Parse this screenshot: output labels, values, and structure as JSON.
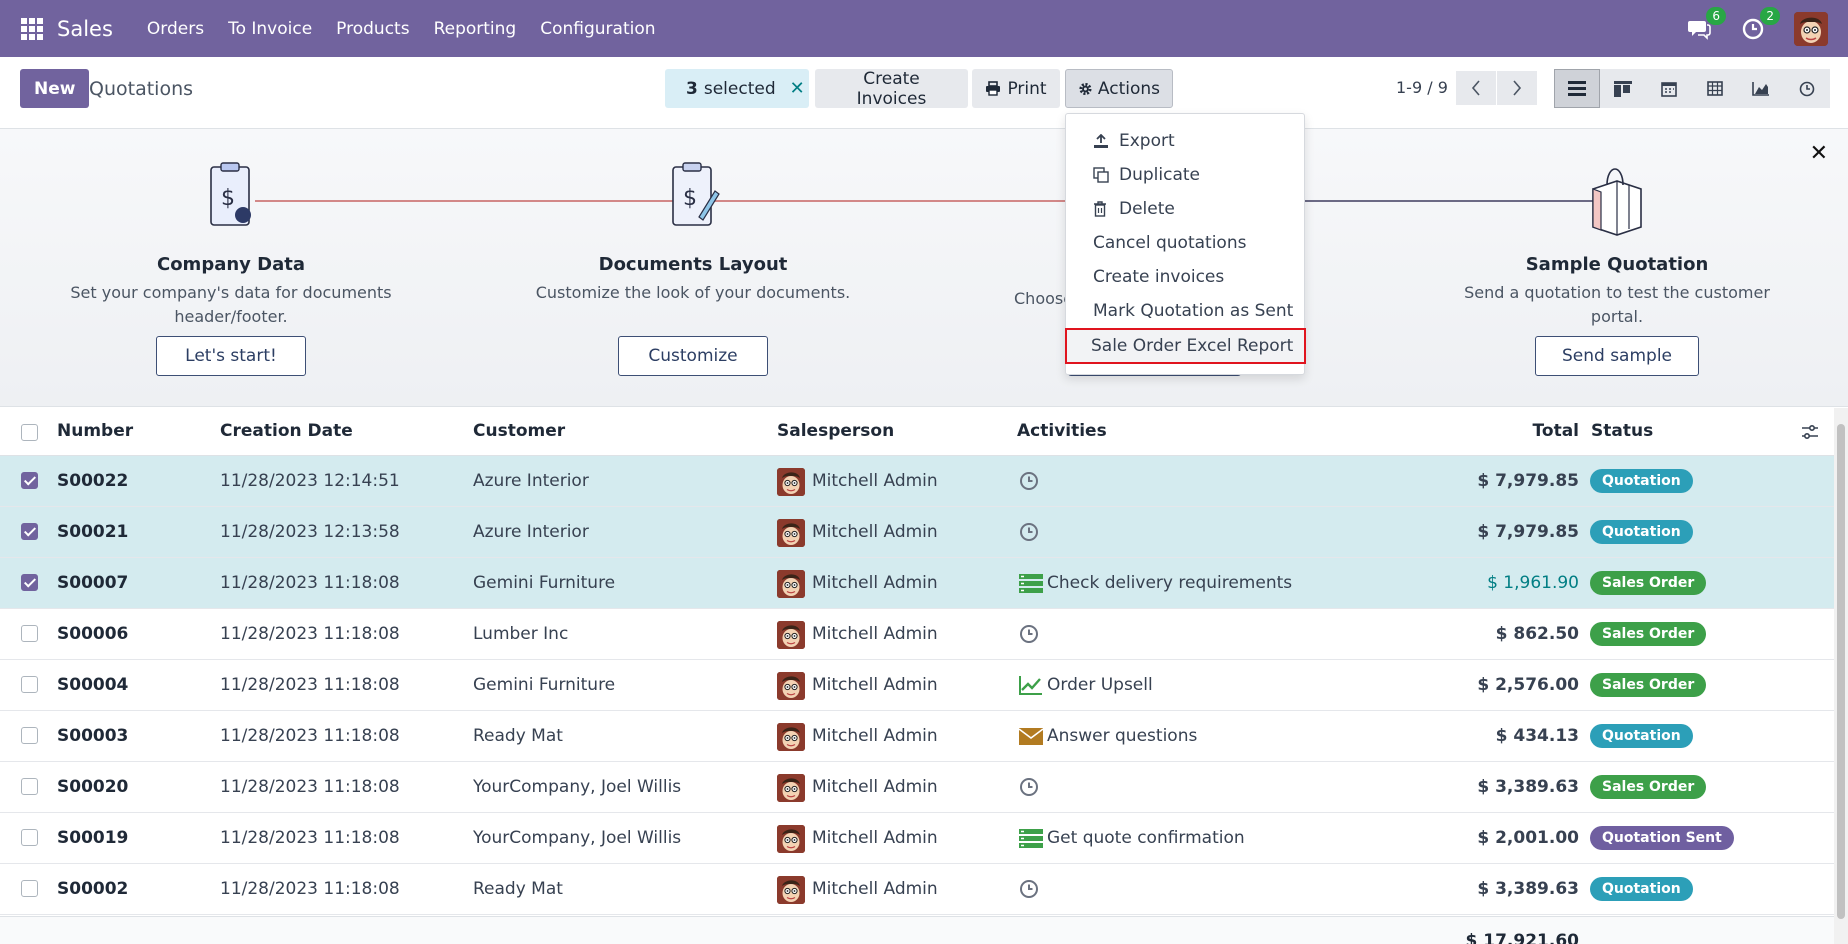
{
  "navbar": {
    "brand": "Sales",
    "items": [
      "Orders",
      "To Invoice",
      "Products",
      "Reporting",
      "Configuration"
    ],
    "messages_count": "6",
    "activities_count": "2"
  },
  "control": {
    "new_label": "New",
    "title": "Quotations",
    "selected_count": "3",
    "selected_label": "selected",
    "create_invoices": "Create Invoices",
    "print": "Print",
    "actions": "Actions",
    "pager": "1-9 / 9"
  },
  "actions_menu": [
    {
      "label": "Export",
      "icon": "upload-icon"
    },
    {
      "label": "Duplicate",
      "icon": "copy-icon"
    },
    {
      "label": "Delete",
      "icon": "trash-icon"
    },
    {
      "label": "Cancel quotations",
      "icon": ""
    },
    {
      "label": "Create invoices",
      "icon": ""
    },
    {
      "label": "Mark Quotation as Sent",
      "icon": ""
    },
    {
      "label": "Sale Order Excel Report",
      "icon": ""
    }
  ],
  "banner": {
    "steps": [
      {
        "title": "Company Data",
        "desc1": "Set your company's data for documents",
        "desc2": "header/footer.",
        "button": "Let's start!"
      },
      {
        "title": "Documents Layout",
        "desc1": "Customize the look of your documents.",
        "desc2": "",
        "button": "Customize"
      },
      {
        "title": "",
        "desc1": "Choose",
        "desc2": "",
        "button": ""
      },
      {
        "title": "Sample Quotation",
        "desc1": "Send a quotation to test the customer",
        "desc2": "portal.",
        "button": "Send sample"
      }
    ]
  },
  "table": {
    "headers": {
      "number": "Number",
      "date": "Creation Date",
      "customer": "Customer",
      "salesperson": "Salesperson",
      "activities": "Activities",
      "total": "Total",
      "status": "Status"
    },
    "rows": [
      {
        "number": "S00022",
        "date": "11/28/2023 12:14:51",
        "customer": "Azure Interior",
        "salesperson": "Mitchell Admin",
        "activity": "",
        "activity_icon": "clock-icon",
        "total": "$ 7,979.85",
        "status": "Quotation",
        "selected": true
      },
      {
        "number": "S00021",
        "date": "11/28/2023 12:13:58",
        "customer": "Azure Interior",
        "salesperson": "Mitchell Admin",
        "activity": "",
        "activity_icon": "clock-icon",
        "total": "$ 7,979.85",
        "status": "Quotation",
        "selected": true
      },
      {
        "number": "S00007",
        "date": "11/28/2023 11:18:08",
        "customer": "Gemini Furniture",
        "salesperson": "Mitchell Admin",
        "activity": "Check delivery requirements",
        "activity_icon": "tasks-icon",
        "total": "$ 1,961.90",
        "status": "Sales Order",
        "selected": true
      },
      {
        "number": "S00006",
        "date": "11/28/2023 11:18:08",
        "customer": "Lumber Inc",
        "salesperson": "Mitchell Admin",
        "activity": "",
        "activity_icon": "clock-icon",
        "total": "$ 862.50",
        "status": "Sales Order",
        "selected": false
      },
      {
        "number": "S00004",
        "date": "11/28/2023 11:18:08",
        "customer": "Gemini Furniture",
        "salesperson": "Mitchell Admin",
        "activity": "Order Upsell",
        "activity_icon": "chart-line-icon",
        "total": "$ 2,576.00",
        "status": "Sales Order",
        "selected": false
      },
      {
        "number": "S00003",
        "date": "11/28/2023 11:18:08",
        "customer": "Ready Mat",
        "salesperson": "Mitchell Admin",
        "activity": "Answer questions",
        "activity_icon": "envelope-icon",
        "total": "$ 434.13",
        "status": "Quotation",
        "selected": false
      },
      {
        "number": "S00020",
        "date": "11/28/2023 11:18:08",
        "customer": "YourCompany, Joel Willis",
        "salesperson": "Mitchell Admin",
        "activity": "",
        "activity_icon": "clock-icon",
        "total": "$ 3,389.63",
        "status": "Sales Order",
        "selected": false
      },
      {
        "number": "S00019",
        "date": "11/28/2023 11:18:08",
        "customer": "YourCompany, Joel Willis",
        "salesperson": "Mitchell Admin",
        "activity": "Get quote confirmation",
        "activity_icon": "tasks-icon",
        "total": "$ 2,001.00",
        "status": "Quotation Sent",
        "selected": false
      },
      {
        "number": "S00002",
        "date": "11/28/2023 11:18:08",
        "customer": "Ready Mat",
        "salesperson": "Mitchell Admin",
        "activity": "",
        "activity_icon": "clock-icon",
        "total": "$ 3,389.63",
        "status": "Quotation",
        "selected": false
      }
    ],
    "footer_total": "$ 17,921.60"
  },
  "colors": {
    "brand": "#71639e",
    "quotation": "#2c9fb8",
    "sales_order": "#3da049",
    "quotation_sent": "#6f5fa0",
    "link_total": "#017e84",
    "highlight_border": "#e0141e"
  }
}
